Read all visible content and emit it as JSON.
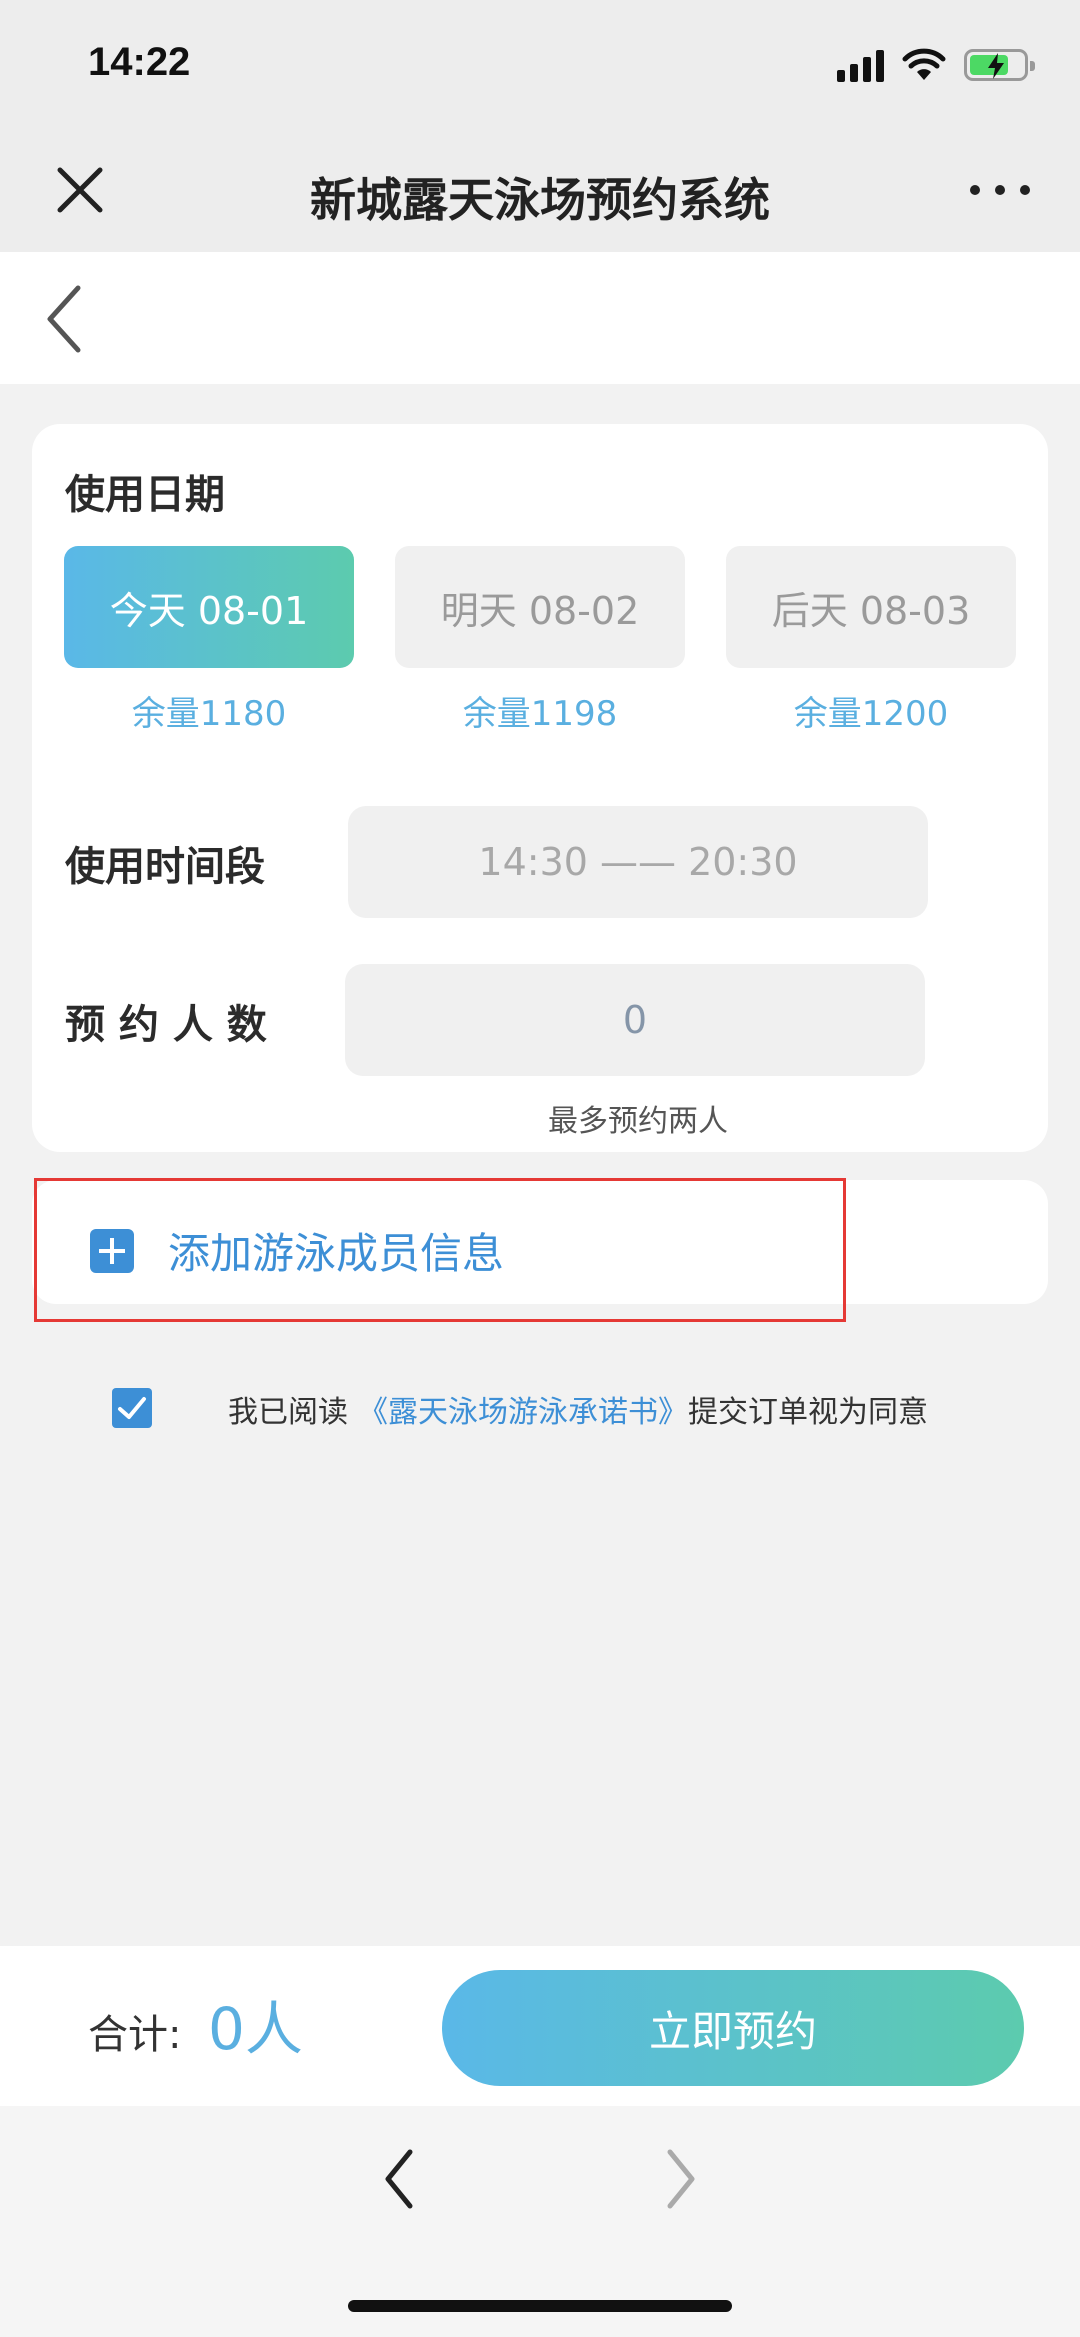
{
  "status_bar": {
    "time": "14:22",
    "icons": [
      "signal-icon",
      "wifi-icon",
      "battery-charging-icon"
    ]
  },
  "header": {
    "title": "新城露天泳场预约系统",
    "close_icon": "close-icon",
    "more_icon": "more-icon"
  },
  "back_bar": {
    "icon": "chevron-left-icon"
  },
  "date_section": {
    "label": "使用日期",
    "options": [
      {
        "label": "今天 08-01",
        "remaining": "余量1180",
        "selected": true
      },
      {
        "label": "明天 08-02",
        "remaining": "余量1198",
        "selected": false
      },
      {
        "label": "后天 08-03",
        "remaining": "余量1200",
        "selected": false
      }
    ]
  },
  "time_section": {
    "label": "使用时间段",
    "value": "14:30 —— 20:30"
  },
  "people_section": {
    "label": "预 约 人 数",
    "value": "0",
    "hint": "最多预约两人"
  },
  "add_member": {
    "label": "添加游泳成员信息",
    "icon": "plus-square-icon"
  },
  "agreement": {
    "checked": true,
    "prefix": "我已阅读",
    "link": "《露天泳场游泳承诺书》",
    "suffix": "提交订单视为同意"
  },
  "footer": {
    "total_label": "合计:",
    "total_value": "0人",
    "submit_label": "立即预约"
  },
  "browser_nav": {
    "back_icon": "chevron-left-icon",
    "forward_icon": "chevron-right-icon"
  },
  "colors": {
    "accent_blue": "#3d8fd6",
    "remaining_text": "#5aafe0",
    "gradient_start": "#5ab8e8",
    "gradient_end": "#5ccbae",
    "highlight_border": "#e53935"
  }
}
